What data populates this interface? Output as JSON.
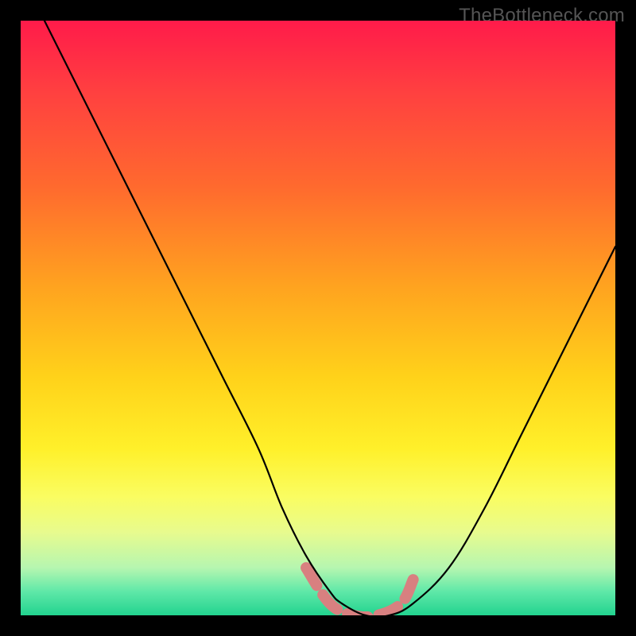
{
  "watermark": "TheBottleneck.com",
  "chart_data": {
    "type": "line",
    "title": "",
    "xlabel": "",
    "ylabel": "",
    "xlim": [
      0,
      100
    ],
    "ylim": [
      0,
      100
    ],
    "background_gradient": [
      "#ff1b4a",
      "#ffd21a",
      "#22d38f"
    ],
    "series": [
      {
        "name": "bottleneck-curve",
        "color": "#000000",
        "x": [
          4,
          10,
          16,
          22,
          28,
          34,
          40,
          44,
          48,
          52,
          54,
          58,
          62,
          66,
          72,
          78,
          84,
          90,
          96,
          100
        ],
        "y": [
          100,
          88,
          76,
          64,
          52,
          40,
          28,
          18,
          10,
          4,
          2,
          0,
          0,
          2,
          8,
          18,
          30,
          42,
          54,
          62
        ]
      }
    ],
    "highlight_segment": {
      "name": "optimal-range",
      "color": "#d88080",
      "dashed": true,
      "x": [
        48,
        52,
        56,
        60,
        64,
        66
      ],
      "y": [
        8,
        2,
        0,
        0,
        2,
        6
      ]
    }
  }
}
